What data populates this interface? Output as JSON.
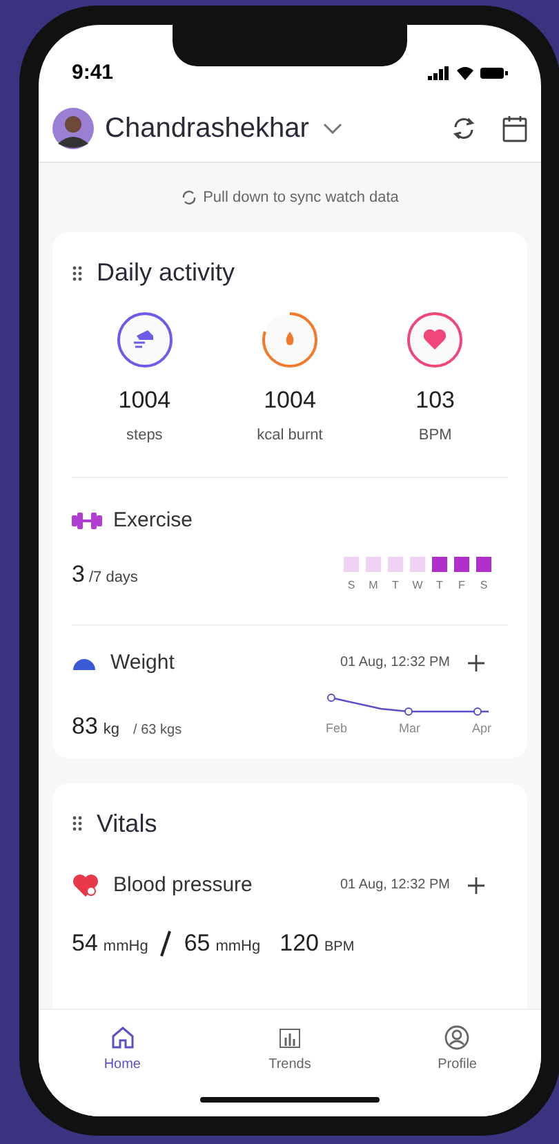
{
  "status_bar": {
    "time": "9:41"
  },
  "header": {
    "user_name": "Chandrashekhar"
  },
  "sync_hint": "Pull down to sync watch data",
  "daily_activity": {
    "title": "Daily activity",
    "stats": [
      {
        "kind": "steps",
        "value": "1004",
        "unit": "steps"
      },
      {
        "kind": "calories",
        "value": "1004",
        "unit": "kcal burnt"
      },
      {
        "kind": "heart",
        "value": "103",
        "unit": "BPM"
      }
    ],
    "exercise": {
      "title": "Exercise",
      "value": "3",
      "suffix": "/7 days",
      "days": [
        {
          "label": "S",
          "done": false
        },
        {
          "label": "M",
          "done": false
        },
        {
          "label": "T",
          "done": false
        },
        {
          "label": "W",
          "done": false
        },
        {
          "label": "T",
          "done": true
        },
        {
          "label": "F",
          "done": true
        },
        {
          "label": "S",
          "done": true
        }
      ]
    },
    "weight": {
      "title": "Weight",
      "timestamp": "01 Aug, 12:32 PM",
      "value": "83",
      "unit": "kg",
      "target": "/ 63 kgs",
      "months": [
        "Feb",
        "Mar",
        "Apr"
      ]
    }
  },
  "vitals": {
    "title": "Vitals",
    "blood_pressure": {
      "title": "Blood pressure",
      "timestamp": "01 Aug, 12:32 PM",
      "readings": [
        {
          "value": "54",
          "unit": "mmHg"
        },
        {
          "value": "65",
          "unit": "mmHg"
        }
      ],
      "pulse": {
        "value": "120",
        "unit": "BPM"
      }
    }
  },
  "nav": [
    {
      "kind": "home",
      "label": "Home",
      "selected": true
    },
    {
      "kind": "trends",
      "label": "Trends",
      "selected": false
    },
    {
      "kind": "profile",
      "label": "Profile",
      "selected": false
    }
  ]
}
